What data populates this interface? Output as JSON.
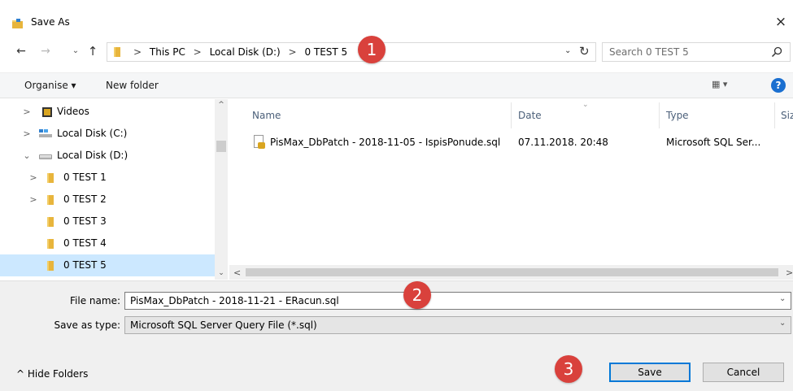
{
  "window": {
    "title": "Save As",
    "close_glyph": "×"
  },
  "nav": {
    "back": "←",
    "forward": "→",
    "recent": "⌄",
    "up": "↑",
    "breadcrumbs": [
      "This PC",
      "Local Disk (D:)",
      "0 TEST 5"
    ],
    "separator": ">",
    "refresh": "↻",
    "dropdown": "⌄"
  },
  "search": {
    "placeholder": "Search 0 TEST 5"
  },
  "toolbar": {
    "organise_label": "Organise ▾",
    "new_folder_label": "New folder",
    "view_label": "▦ ▾",
    "help_label": "?"
  },
  "tree": {
    "items": [
      {
        "label": "Videos",
        "icon": "video-folder-icon",
        "chevron": ">"
      },
      {
        "label": "Local Disk (C:)",
        "icon": "disk-c-icon",
        "chevron": ">"
      },
      {
        "label": "Local Disk (D:)",
        "icon": "disk-d-icon",
        "chevron": "⌄"
      },
      {
        "label": "0 TEST 1",
        "icon": "folder-icon",
        "chevron": ">"
      },
      {
        "label": "0 TEST 2",
        "icon": "folder-icon",
        "chevron": ">"
      },
      {
        "label": "0 TEST 3",
        "icon": "folder-icon",
        "chevron": ""
      },
      {
        "label": "0 TEST 4",
        "icon": "folder-icon",
        "chevron": ""
      },
      {
        "label": "0 TEST 5",
        "icon": "folder-icon",
        "chevron": "",
        "selected": true
      }
    ],
    "scroll_up": "^",
    "scroll_down": "⌄"
  },
  "list": {
    "columns": [
      "Name",
      "Date",
      "Type",
      "Size"
    ],
    "rows": [
      {
        "name": "PisMax_DbPatch - 2018-11-05 - IspisPonude.sql",
        "date": "07.11.2018. 20:48",
        "type": "Microsoft SQL Ser..."
      }
    ],
    "scroll_left": "<",
    "scroll_right": ">"
  },
  "form": {
    "filename_label": "File name:",
    "filename_value": "PisMax_DbPatch - 2018-11-21 - ERacun.sql",
    "savetype_label": "Save as type:",
    "savetype_value": "Microsoft SQL Server Query File (*.sql)",
    "dropdown": "⌄"
  },
  "footer": {
    "hide_folders": "^ Hide Folders",
    "save_label": "Save",
    "cancel_label": "Cancel"
  },
  "callouts": [
    "1",
    "2",
    "3"
  ],
  "colors": {
    "callout": "#d9413c",
    "selection": "#cce8ff",
    "accent": "#0078d7"
  }
}
